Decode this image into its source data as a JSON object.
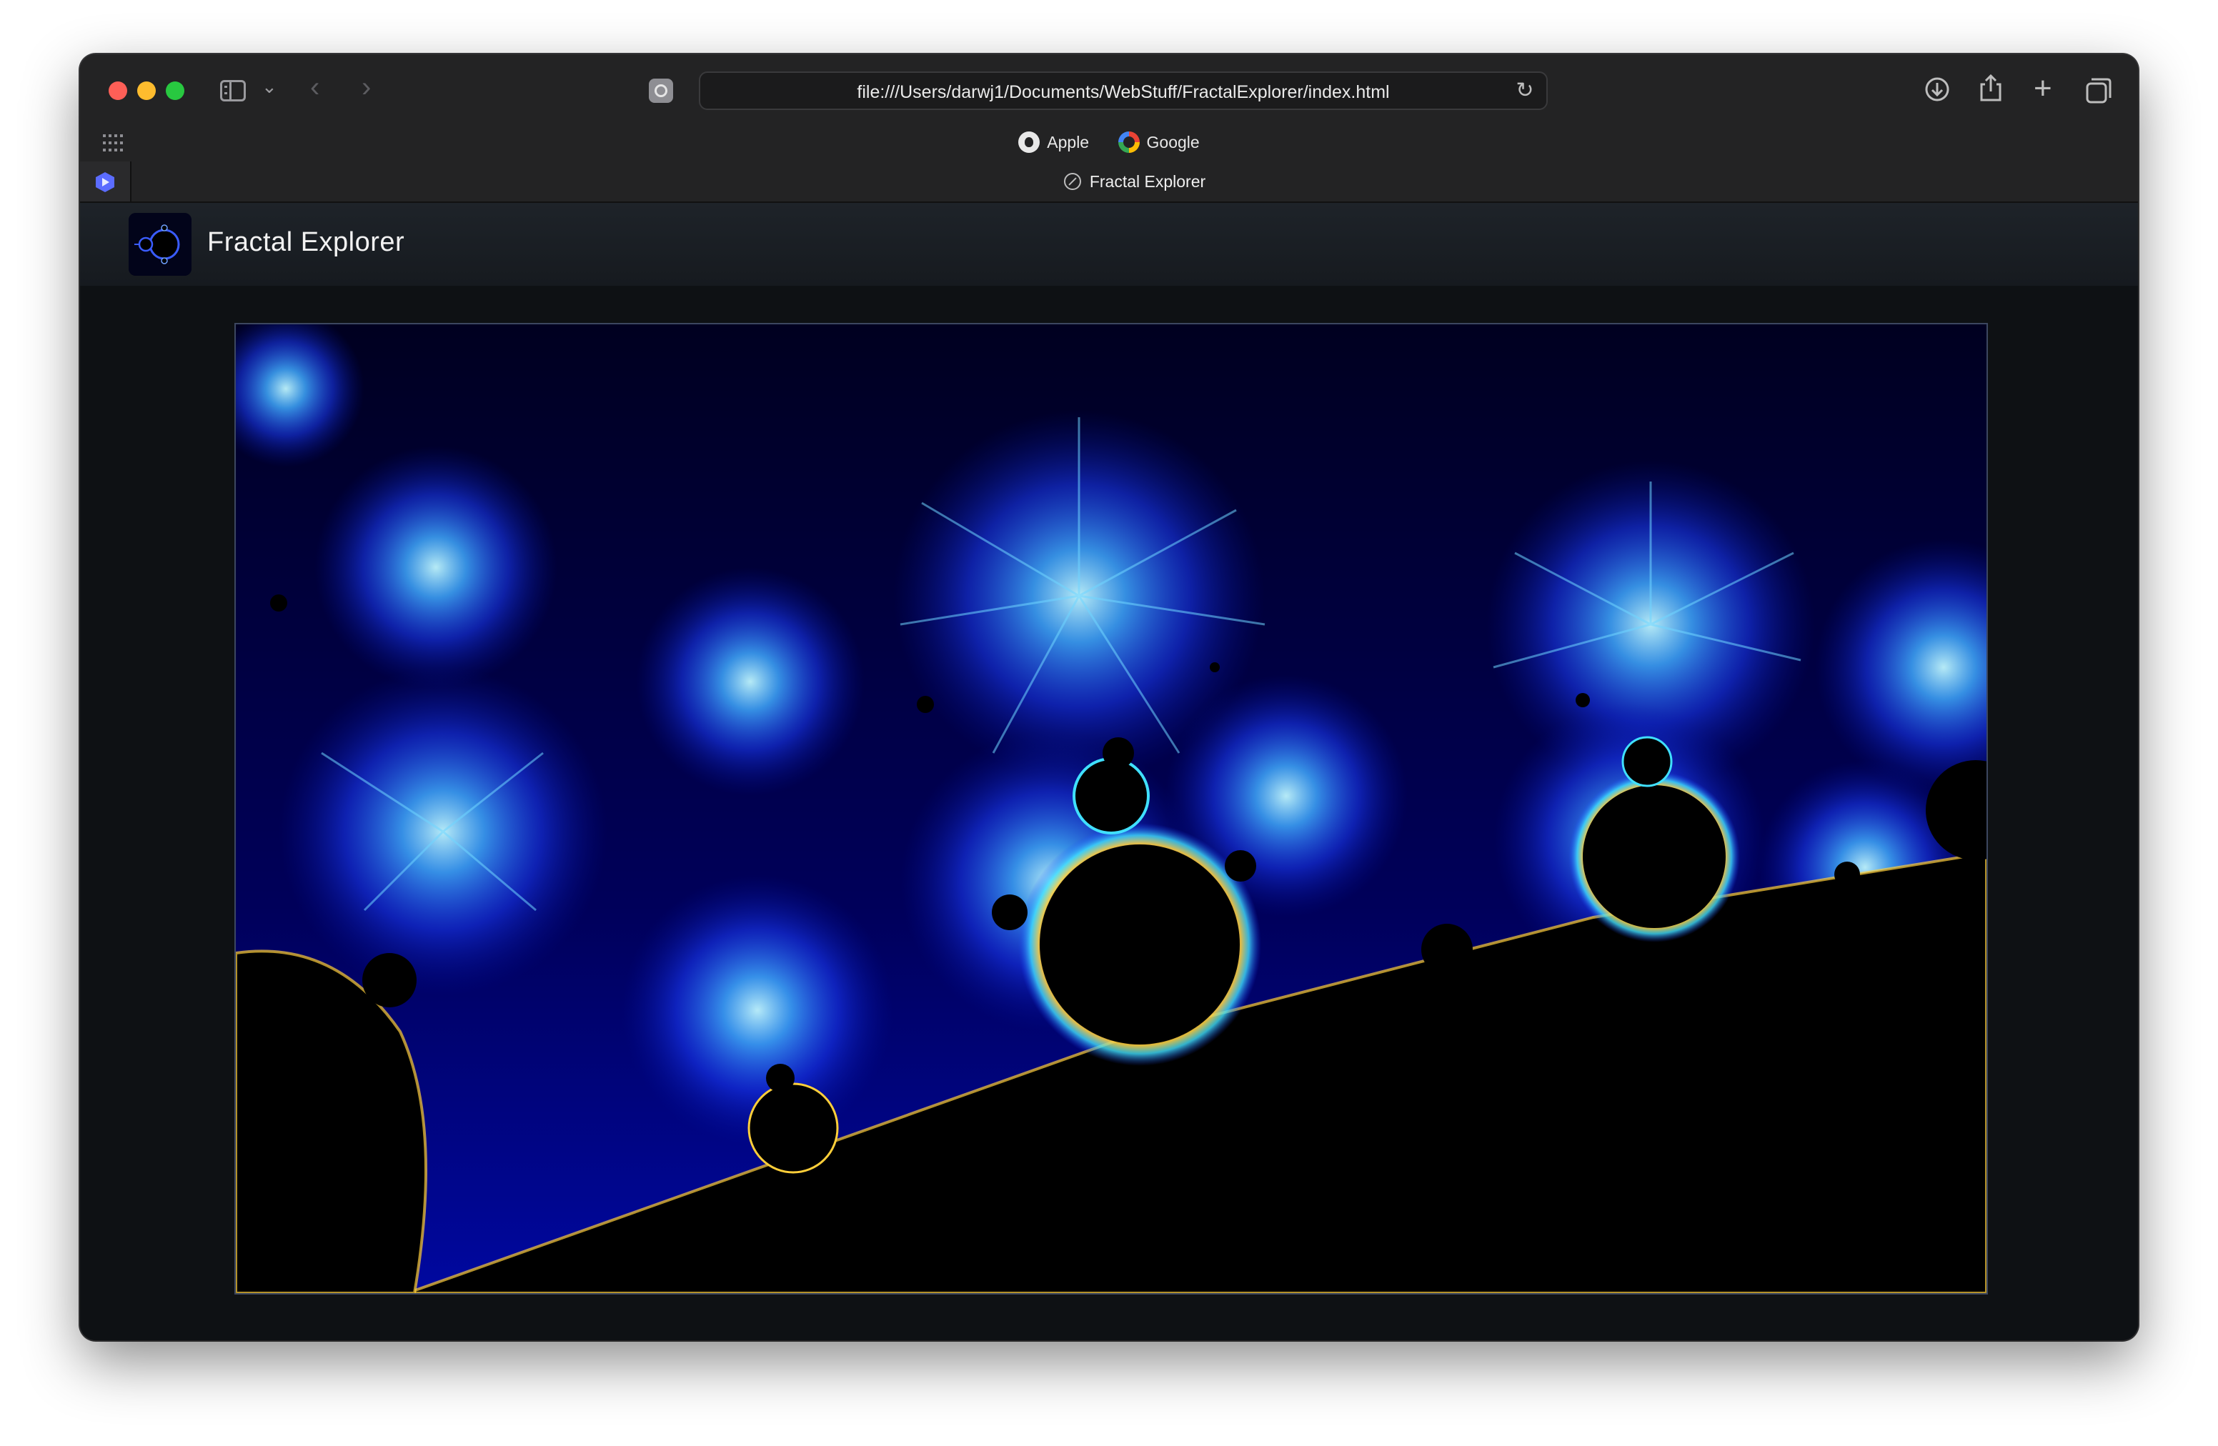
{
  "browser": {
    "address_url": "file:///Users/darwj1/Documents/WebStuff/FractalExplorer/index.html",
    "bookmarks": [
      {
        "label": "Apple",
        "icon": "apple-icon"
      },
      {
        "label": "Google",
        "icon": "google-icon"
      }
    ],
    "active_tab_title": "Fractal Explorer",
    "icons": {
      "sidebar": "sidebar-icon",
      "back": "back-arrow-icon",
      "forward": "forward-arrow-icon",
      "privacy": "privacy-report-icon",
      "reload": "reload-icon",
      "download": "download-icon",
      "share": "share-icon",
      "new_tab": "plus-icon",
      "tab_overview": "tabs-overview-icon"
    },
    "colors": {
      "close": "#fe5f57",
      "minimize": "#febc2e",
      "maximize": "#28c840"
    }
  },
  "app": {
    "title": "Fractal Explorer",
    "colors": {
      "background_deep": "#00002a",
      "fractal_blue": "#1a4fff",
      "fractal_cyan": "#7fe8ff",
      "set_black": "#000000"
    }
  }
}
